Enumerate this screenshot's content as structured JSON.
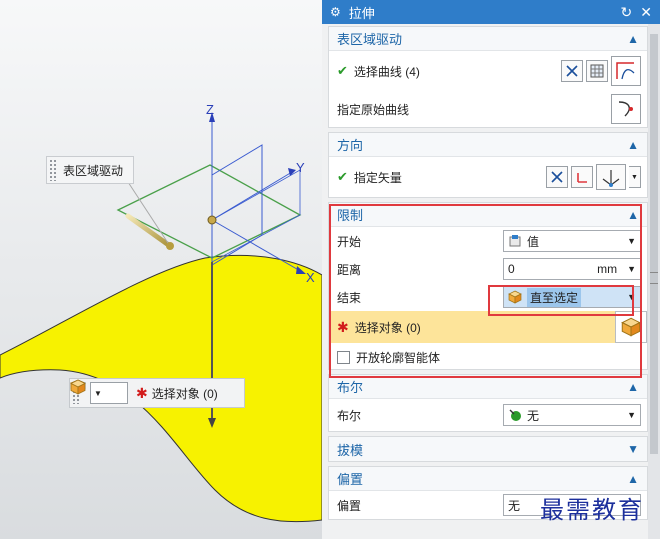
{
  "viewport": {
    "axis_z": "Z",
    "axis_y": "Y",
    "axis_x": "X",
    "tag_label": "表区域驱动",
    "floating_bar": {
      "star": "✱",
      "label": "选择对象 (0)"
    }
  },
  "dialog": {
    "title": "拉伸",
    "sections": {
      "surface_drive": {
        "title": "表区域驱动",
        "select_curve_label": "选择曲线 (4)",
        "origin_curve_label": "指定原始曲线"
      },
      "direction": {
        "title": "方向",
        "vector_label": "指定矢量"
      },
      "limits": {
        "title": "限制",
        "start_label": "开始",
        "start_value": "值",
        "distance_label": "距离",
        "distance_value": "0",
        "distance_unit": "mm",
        "end_label": "结束",
        "end_value": "直至选定",
        "select_object_label": "选择对象 (0)",
        "open_profile_label": "开放轮廓智能体"
      },
      "boolean": {
        "title": "布尔",
        "boolean_label": "布尔",
        "boolean_value": "无"
      },
      "draft": {
        "title": "拔模"
      },
      "offset": {
        "title": "偏置",
        "offset_label": "偏置",
        "offset_value": "无"
      }
    }
  },
  "watermark": "最需教育",
  "colors": {
    "title_bar": "#2f7dc9",
    "surface": "#f7f200",
    "highlight": "#e0393e",
    "required": "#fde49a"
  }
}
